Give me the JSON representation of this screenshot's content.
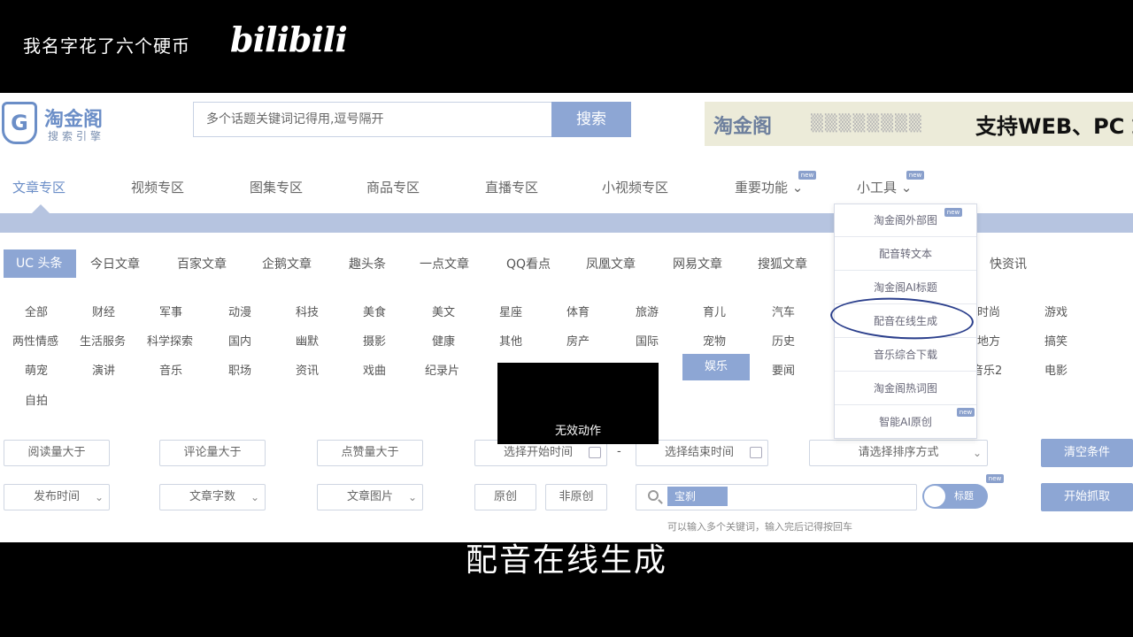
{
  "overlay": {
    "caption": "我名字花了六个硬币",
    "brand": "bilibili",
    "subtitle": "配音在线生成"
  },
  "header": {
    "logo_name": "淘金阁",
    "logo_sub": "搜索引擎",
    "search_placeholder": "多个话题关键词记得用,逗号隔开",
    "search_button": "搜索",
    "banner_logo": "淘金阁",
    "banner_text": "支持WEB、PC 端"
  },
  "nav": {
    "items": [
      {
        "label": "文章专区",
        "active": true
      },
      {
        "label": "视频专区"
      },
      {
        "label": "图集专区"
      },
      {
        "label": "商品专区"
      },
      {
        "label": "直播专区"
      },
      {
        "label": "小视频专区"
      },
      {
        "label": "重要功能",
        "badge": "new"
      },
      {
        "label": "小工具",
        "badge": "new"
      }
    ]
  },
  "sources": [
    "UC 头条",
    "今日文章",
    "百家文章",
    "企鹅文章",
    "趣头条",
    "一点文章",
    "QQ看点",
    "凤凰文章",
    "网易文章",
    "搜狐文章",
    "快资讯"
  ],
  "categories": {
    "row1": [
      "全部",
      "财经",
      "军事",
      "动漫",
      "科技",
      "美食",
      "美文",
      "星座",
      "体育",
      "旅游",
      "育儿",
      "汽车",
      "时尚",
      "游戏"
    ],
    "row2": [
      "两性情感",
      "生活服务",
      "科学探索",
      "国内",
      "幽默",
      "摄影",
      "健康",
      "其他",
      "房产",
      "国际",
      "宠物",
      "历史",
      "地方",
      "搞笑"
    ],
    "row3": [
      "萌宠",
      "演讲",
      "音乐",
      "职场",
      "资讯",
      "戏曲",
      "纪录片",
      "娱乐",
      "要闻",
      "音乐2",
      "电影"
    ],
    "row4": [
      "自拍"
    ]
  },
  "dropdown": {
    "items": [
      "淘金阁外部图",
      "配音转文本",
      "淘金阁AI标题",
      "配音在线生成",
      "音乐综合下载",
      "淘金阁热词图",
      "智能AI原创"
    ],
    "badges": [
      "new",
      "new"
    ]
  },
  "toast": "无效动作",
  "filters": {
    "row1": [
      "阅读量大于",
      "评论量大于",
      "点赞量大于",
      "选择开始时间",
      "选择结束时间",
      "请选择排序方式",
      "清空条件"
    ],
    "row2": [
      "发布时间",
      "文章字数",
      "文章图片",
      "原创",
      "非原创",
      "标题",
      "开始抓取"
    ],
    "keyword_tag": "宝刹",
    "hint": "可以输入多个关键词，输入完后记得按回车",
    "date_separator": "-"
  },
  "colors": {
    "accent": "#8da6d4",
    "brand": "#6b8ec7",
    "band": "#b6c4e0"
  }
}
